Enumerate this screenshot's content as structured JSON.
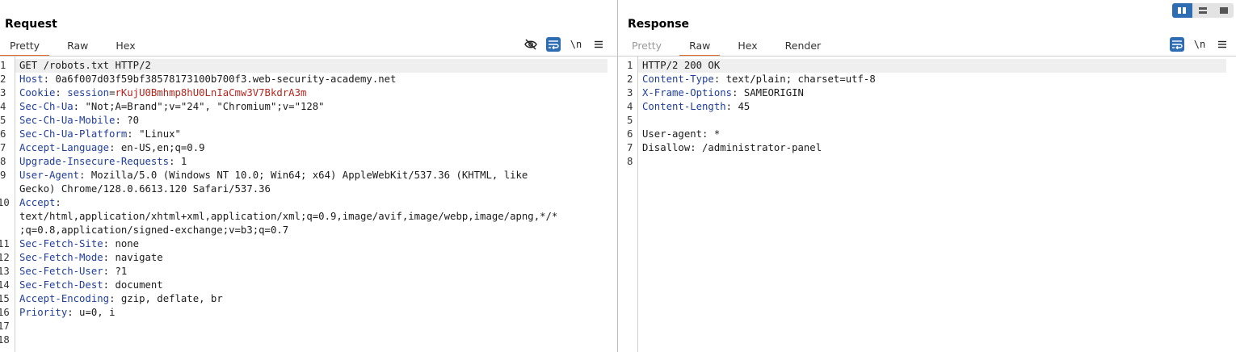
{
  "colors": {
    "accent": "#2f6db3",
    "tab_underline": "#e06a2c",
    "header_name": "#1f3e9c",
    "cookie_value": "#b3261e",
    "active_line": "#efefef"
  },
  "layout_toggle": {
    "icons": [
      "split-vertical-icon",
      "split-horizontal-icon",
      "single-pane-icon"
    ],
    "active": 0
  },
  "request": {
    "title": "Request",
    "tabs": [
      "Pretty",
      "Raw",
      "Hex"
    ],
    "active_tab": 0,
    "tools": {
      "hide_icon": "eye-slash-icon",
      "wrap_icon": "wrap-lines-icon",
      "newline_label": "\\n",
      "menu_icon": "hamburger-menu-icon"
    },
    "lines": [
      {
        "n": "1",
        "text": "GET /robots.txt HTTP/2"
      },
      {
        "n": "2",
        "name": "Host",
        "value": "0a6f007d03f59bf38578173100b700f3.web-security-academy.net"
      },
      {
        "n": "3",
        "name": "Cookie",
        "cookie_name": "session",
        "cookie_value": "rKujU0Bmhmp8hU0LnIaCmw3V7BkdrA3m"
      },
      {
        "n": "4",
        "name": "Sec-Ch-Ua",
        "value": "\"Not;A=Brand\";v=\"24\", \"Chromium\";v=\"128\""
      },
      {
        "n": "5",
        "name": "Sec-Ch-Ua-Mobile",
        "value": "?0"
      },
      {
        "n": "6",
        "name": "Sec-Ch-Ua-Platform",
        "value": "\"Linux\""
      },
      {
        "n": "7",
        "name": "Accept-Language",
        "value": "en-US,en;q=0.9"
      },
      {
        "n": "8",
        "name": "Upgrade-Insecure-Requests",
        "value": "1"
      },
      {
        "n": "9",
        "name": "User-Agent",
        "value": "Mozilla/5.0 (Windows NT 10.0; Win64; x64) AppleWebKit/537.36 (KHTML, like",
        "continuation": [
          "Gecko) Chrome/128.0.6613.120 Safari/537.36"
        ]
      },
      {
        "n": "10",
        "name": "Accept",
        "value": "",
        "continuation": [
          "text/html,application/xhtml+xml,application/xml;q=0.9,image/avif,image/webp,image/apng,*/*",
          ";q=0.8,application/signed-exchange;v=b3;q=0.7"
        ]
      },
      {
        "n": "11",
        "name": "Sec-Fetch-Site",
        "value": "none"
      },
      {
        "n": "12",
        "name": "Sec-Fetch-Mode",
        "value": "navigate"
      },
      {
        "n": "13",
        "name": "Sec-Fetch-User",
        "value": "?1"
      },
      {
        "n": "14",
        "name": "Sec-Fetch-Dest",
        "value": "document"
      },
      {
        "n": "15",
        "name": "Accept-Encoding",
        "value": "gzip, deflate, br"
      },
      {
        "n": "16",
        "name": "Priority",
        "value": "u=0, i"
      },
      {
        "n": "17",
        "text": ""
      },
      {
        "n": "18",
        "text": ""
      }
    ]
  },
  "response": {
    "title": "Response",
    "tabs": [
      "Pretty",
      "Raw",
      "Hex",
      "Render"
    ],
    "active_tab": 1,
    "disabled_tabs": [
      0
    ],
    "tools": {
      "wrap_icon": "wrap-lines-icon",
      "newline_label": "\\n",
      "menu_icon": "hamburger-menu-icon"
    },
    "lines": [
      {
        "n": "1",
        "text": "HTTP/2 200 OK"
      },
      {
        "n": "2",
        "name": "Content-Type",
        "value": "text/plain; charset=utf-8"
      },
      {
        "n": "3",
        "name": "X-Frame-Options",
        "value": "SAMEORIGIN"
      },
      {
        "n": "4",
        "name": "Content-Length",
        "value": "45"
      },
      {
        "n": "5",
        "text": ""
      },
      {
        "n": "6",
        "text": "User-agent: *"
      },
      {
        "n": "7",
        "text": "Disallow: /administrator-panel"
      },
      {
        "n": "8",
        "text": ""
      }
    ]
  }
}
